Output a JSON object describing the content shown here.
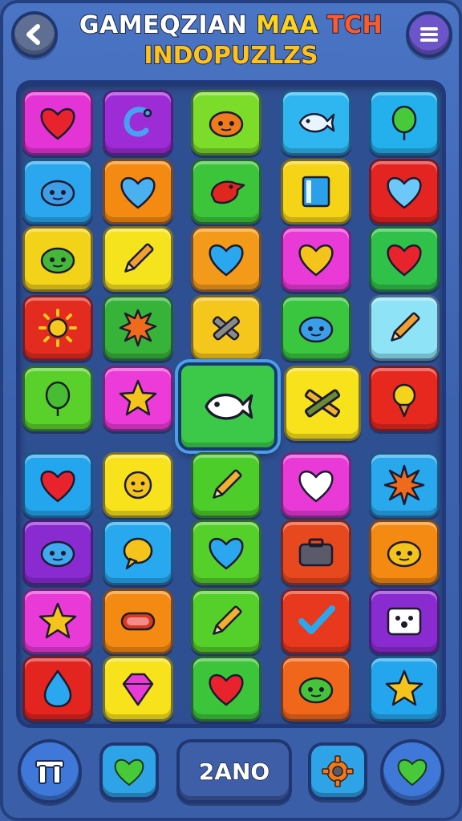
{
  "header": {
    "title_part1": "GAMEQZIAN ",
    "title_part2": "MAA ",
    "title_part3": "TCH",
    "subtitle": "INDOPUZLZS"
  },
  "bottom_bar": {
    "score_label": "2ANO"
  },
  "board": {
    "rows": [
      [
        {
          "color": "#e534d6",
          "icon": "heart",
          "icon_color": "#e8232e"
        },
        {
          "color": "#9d2bd6",
          "icon": "hook",
          "icon_color": "#4aa0f0"
        },
        {
          "color": "#7bdc2a",
          "icon": "orange-blob",
          "icon_color": "#f07a1c"
        },
        {
          "color": "#2fb6f0",
          "icon": "fish",
          "icon_color": "#e8f4ff"
        },
        {
          "color": "#23b0ec",
          "icon": "balloon",
          "icon_color": "#47c93a"
        }
      ],
      [
        {
          "color": "#2aa7ee",
          "icon": "blue-blob",
          "icon_color": "#3f9de8"
        },
        {
          "color": "#f48a12",
          "icon": "heart",
          "icon_color": "#4ab0f0"
        },
        {
          "color": "#3cc43a",
          "icon": "bird",
          "icon_color": "#e0271f"
        },
        {
          "color": "#f5d418",
          "icon": "book",
          "icon_color": "#2aa0ea"
        },
        {
          "color": "#e42421",
          "icon": "heart",
          "icon_color": "#6cc8f8"
        }
      ],
      [
        {
          "color": "#f3d21a",
          "icon": "green-blob",
          "icon_color": "#45b83a"
        },
        {
          "color": "#f5e31e",
          "icon": "pencil",
          "icon_color": "#f0a030"
        },
        {
          "color": "#f39a1a",
          "icon": "heart",
          "icon_color": "#2aa7ee"
        },
        {
          "color": "#e93ad8",
          "icon": "heart",
          "icon_color": "#f5c41c"
        },
        {
          "color": "#2fc14a",
          "icon": "heart",
          "icon_color": "#e8232e"
        }
      ],
      [
        {
          "color": "#e32b1f",
          "icon": "sun",
          "icon_color": "#f7c81c"
        },
        {
          "color": "#37b33a",
          "icon": "spiky",
          "icon_color": "#f06a1c"
        },
        {
          "color": "#f5c71c",
          "icon": "crossed-sticks",
          "icon_color": "#8a8a8a"
        },
        {
          "color": "#3ac63f",
          "icon": "blue-blob",
          "icon_color": "#3a9ee8"
        },
        {
          "color": "#8fe3f7",
          "icon": "pencil",
          "icon_color": "#f0a030"
        }
      ],
      [
        {
          "color": "#5ad12a",
          "icon": "balloon",
          "icon_color": "#46bd33"
        },
        {
          "color": "#ec3bd8",
          "icon": "star",
          "icon_color": "#f5c41c"
        },
        {
          "color": "#3cc94a",
          "icon": "fish",
          "icon_color": "#ffffff"
        },
        {
          "color": "#f8e21c",
          "icon": "crossed-pencils",
          "icon_color": "#e07a1c"
        },
        {
          "color": "#e7281e",
          "icon": "bulb",
          "icon_color": "#f5d21c"
        }
      ],
      [
        {
          "color": "#24a6ee",
          "icon": "heart",
          "icon_color": "#e8232e"
        },
        {
          "color": "#f8e21c",
          "icon": "sun-face",
          "icon_color": "#f5c41c"
        },
        {
          "color": "#4ccd2a",
          "icon": "pencil",
          "icon_color": "#f0b030"
        },
        {
          "color": "#e93ad8",
          "icon": "heart",
          "icon_color": "#ffffff"
        },
        {
          "color": "#29a8ee",
          "icon": "burst",
          "icon_color": "#f06a1c"
        }
      ],
      [
        {
          "color": "#8a2bd2",
          "icon": "blue-blob",
          "icon_color": "#3fa8ee"
        },
        {
          "color": "#28a8ee",
          "icon": "speech",
          "icon_color": "#f5c41c"
        },
        {
          "color": "#55cf2a",
          "icon": "heart",
          "icon_color": "#2aa7ee"
        },
        {
          "color": "#e8481e",
          "icon": "case",
          "icon_color": "#5a5a6a"
        },
        {
          "color": "#f48a12",
          "icon": "yellow-blob",
          "icon_color": "#f5c41c"
        }
      ],
      [
        {
          "color": "#e93ad8",
          "icon": "star",
          "icon_color": "#f5c41c"
        },
        {
          "color": "#f48a12",
          "icon": "pill",
          "icon_color": "#d83a1e"
        },
        {
          "color": "#55cf2a",
          "icon": "pencil",
          "icon_color": "#f0b030"
        },
        {
          "color": "#e8381e",
          "icon": "check",
          "icon_color": "#2aa7ee"
        },
        {
          "color": "#8a2bd2",
          "icon": "dice",
          "icon_color": "#ffffff"
        }
      ],
      [
        {
          "color": "#e3241f",
          "icon": "drop",
          "icon_color": "#2aa7ee"
        },
        {
          "color": "#f8e21c",
          "icon": "gem",
          "icon_color": "#e93ad8"
        },
        {
          "color": "#3cc43a",
          "icon": "heart",
          "icon_color": "#e8232e"
        },
        {
          "color": "#f0661a",
          "icon": "green-blob",
          "icon_color": "#45c33a"
        },
        {
          "color": "#24a6ee",
          "icon": "star",
          "icon_color": "#f5c41c"
        }
      ]
    ]
  }
}
